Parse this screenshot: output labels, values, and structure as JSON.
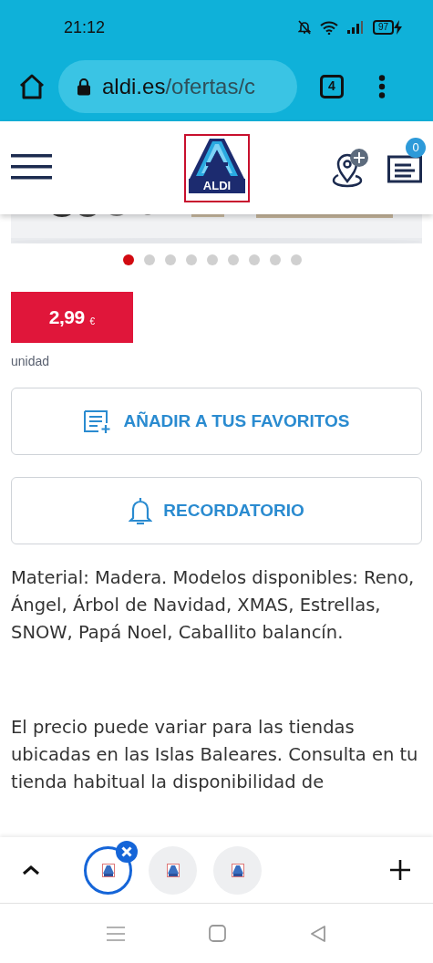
{
  "status_bar": {
    "time": "21:12",
    "battery": "97"
  },
  "browser_toolbar": {
    "url_domain": "aldi.es",
    "url_path": "/ofertas/c",
    "tab_count": "4"
  },
  "site_header": {
    "logo_text": "ALDI",
    "cart_count": "0"
  },
  "carousel": {
    "dots": [
      {
        "selected": true
      },
      {
        "selected": false
      },
      {
        "selected": false
      },
      {
        "selected": false
      },
      {
        "selected": false
      },
      {
        "selected": false
      },
      {
        "selected": false
      },
      {
        "selected": false
      },
      {
        "selected": false
      }
    ]
  },
  "price": {
    "amount": "2,99",
    "currency": "€",
    "unit": "unidad"
  },
  "buttons": [
    {
      "kind": "favorites",
      "label": "AÑADIR A TUS FAVORITOS"
    },
    {
      "kind": "reminder",
      "label": "RECORDATORIO"
    }
  ],
  "description": [
    "Material: Madera. Modelos disponibles: Reno, Ángel, Árbol de Navidad, XMAS, Estrellas, SNOW, Papá Noel, Caballito balancín.",
    "El precio puede variar para las tiendas ubicadas en las Islas Baleares. Consulta en tu tienda habitual la disponibilidad de"
  ],
  "tab_strip": {
    "tabs": [
      {
        "selected": true
      },
      {
        "selected": false
      },
      {
        "selected": false
      }
    ]
  }
}
